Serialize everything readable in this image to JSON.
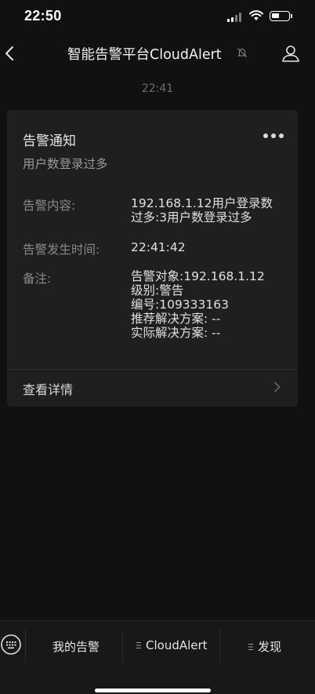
{
  "status_bar": {
    "time": "22:50"
  },
  "nav": {
    "title": "智能告警平台CloudAlert"
  },
  "chat": {
    "timestamp": "22:41"
  },
  "card": {
    "title": "告警通知",
    "subtitle": "用户数登录过多",
    "fields": [
      {
        "label": "告警内容:",
        "lines": [
          "192.168.1.12用户登录数",
          "过多:3用户数登录过多"
        ]
      },
      {
        "label": "告警发生时间:",
        "lines": [
          "22:41:42"
        ]
      },
      {
        "label": "备注:",
        "lines": [
          "告警对象:192.168.1.12",
          "级别:警告",
          "编号:109333163",
          "推荐解决方案: --",
          "实际解决方案: --"
        ]
      }
    ],
    "detail_label": "查看详情"
  },
  "bottom_menu": {
    "items": [
      {
        "label": "我的告警",
        "has_submenu": false
      },
      {
        "label": "CloudAlert",
        "has_submenu": true
      },
      {
        "label": "发现",
        "has_submenu": true
      }
    ]
  },
  "colors": {
    "background": "#111111",
    "card": "#1f1f1f",
    "bottom_bar": "#181818"
  }
}
